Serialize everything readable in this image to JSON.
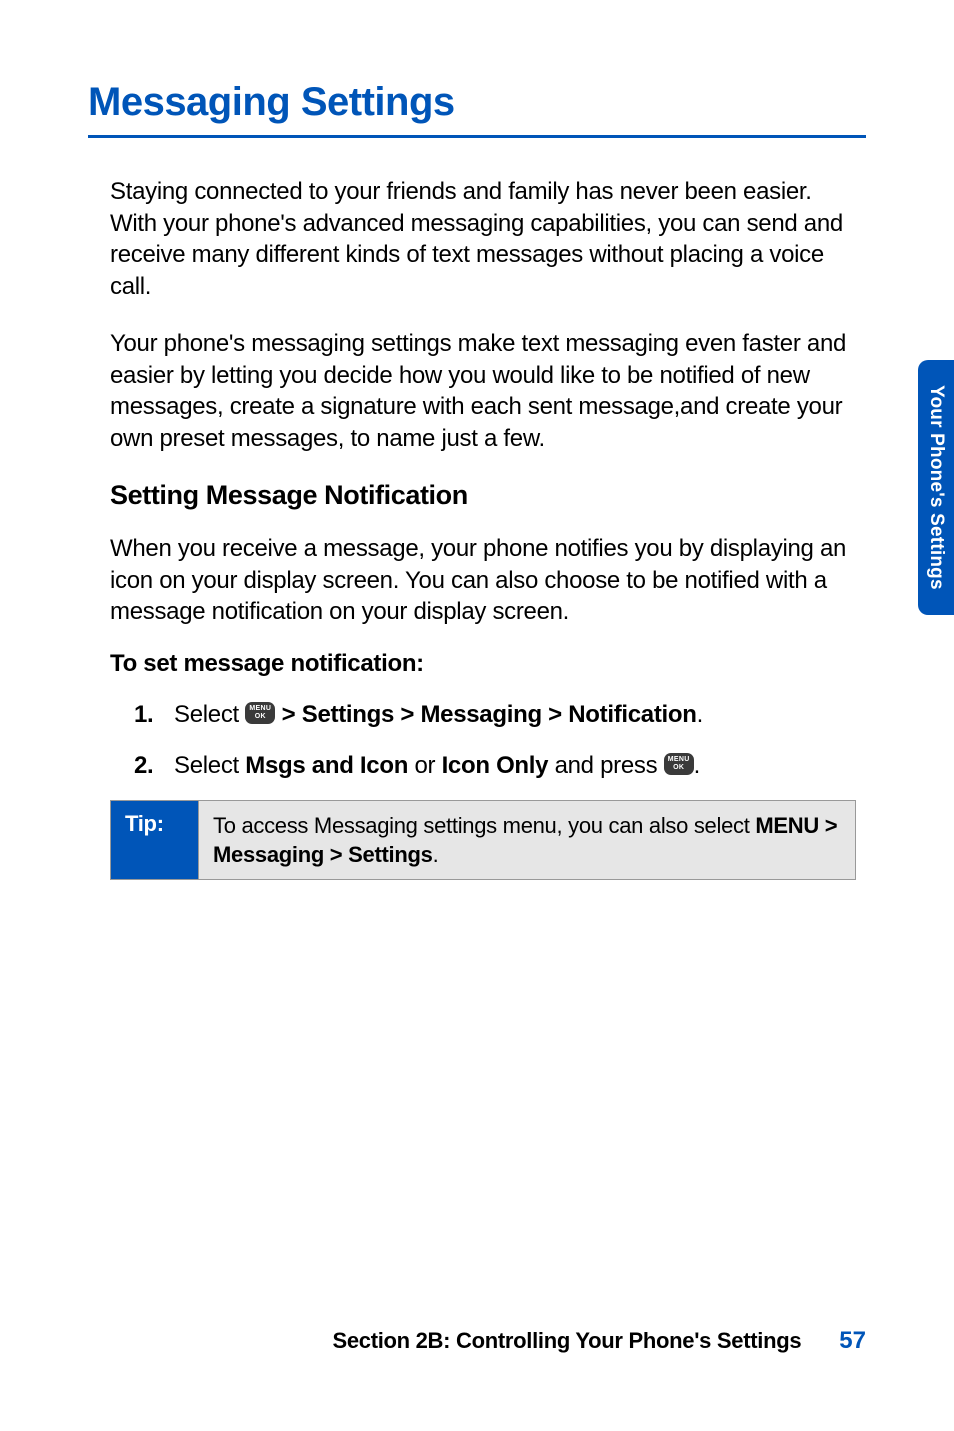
{
  "title": "Messaging Settings",
  "paragraphs": {
    "intro1": "Staying connected to your friends and family has never been easier. With your phone's advanced messaging capabilities, you can send and receive many different kinds of text messages without placing a voice call.",
    "intro2": "Your phone's messaging settings make text messaging even faster and easier by letting you decide how you would like to be notified of new messages, create a signature with each sent message,and create your own preset messages, to name just a few.",
    "notification_intro": "When you receive a message, your phone notifies you by displaying an icon on your display screen. You can also choose to be notified with a message notification on your display screen."
  },
  "headers": {
    "section": "Setting Message Notification",
    "sub": "To set message notification:"
  },
  "steps": {
    "s1": {
      "num": "1.",
      "prefix": "Select",
      "bold_path": " > Settings > Messaging > Notification",
      "suffix": "."
    },
    "s2": {
      "num": "2.",
      "prefix": "Select ",
      "bold1": "Msgs and Icon",
      "mid": " or ",
      "bold2": "Icon Only",
      "mid2": " and press ",
      "suffix": "."
    }
  },
  "menu_icon": {
    "line1": "MENU",
    "line2": "OK"
  },
  "tip": {
    "label": "Tip:",
    "text_prefix": "To access Messaging settings menu, you can also select ",
    "bold_path": "MENU > Messaging > Settings",
    "suffix": "."
  },
  "side_tab": "Your Phone's Settings",
  "footer": {
    "text": "Section 2B: Controlling Your Phone's Settings",
    "page": "57"
  }
}
